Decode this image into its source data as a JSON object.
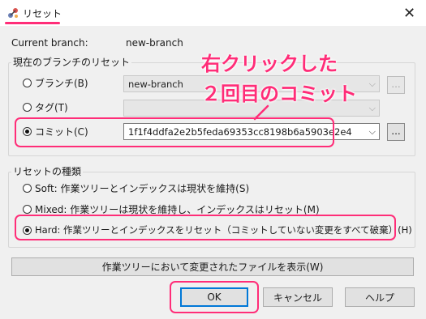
{
  "window": {
    "title": "リセット",
    "close_symbol": "✕"
  },
  "branch": {
    "label": "Current branch:",
    "value": "new-branch"
  },
  "target_group": {
    "title": "現在のブランチのリセット",
    "options": [
      {
        "label": "ブランチ(B)",
        "value": "new-branch",
        "selected": false
      },
      {
        "label": "タグ(T)",
        "value": "",
        "selected": false
      },
      {
        "label": "コミット(C)",
        "value": "1f1f4ddfa2e2b5feda69353cc8198b6a5903e2e4",
        "selected": true
      }
    ],
    "browse_label": "..."
  },
  "type_group": {
    "title": "リセットの種類",
    "options": [
      {
        "label": "Soft: 作業ツリーとインデックスは現状を維持(S)",
        "selected": false
      },
      {
        "label": "Mixed: 作業ツリーは現状を維持し、インデックスはリセット(M)",
        "selected": false
      },
      {
        "label": "Hard: 作業ツリーとインデックスをリセット（コミットしていない変更をすべて破棄）(H)",
        "selected": true
      }
    ]
  },
  "buttons": {
    "show_changed": "作業ツリーにおいて変更されたファイルを表示(W)",
    "ok": "OK",
    "cancel": "キャンセル",
    "help": "ヘルプ"
  },
  "annotation": {
    "line1": "右クリックした",
    "line2": "２回目のコミット"
  },
  "colors": {
    "highlight": "#ff2d78",
    "default_button_border": "#0078d7"
  }
}
